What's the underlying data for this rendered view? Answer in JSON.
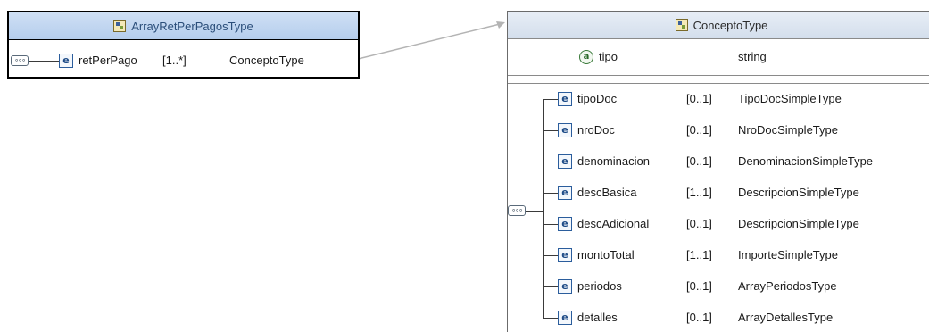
{
  "left_type": {
    "title": "ArrayRetPerPagosType",
    "element": {
      "name": "retPerPago",
      "cardinality": "[1..*]",
      "type": "ConceptoType"
    }
  },
  "right_type": {
    "title": "ConceptoType",
    "attribute": {
      "name": "tipo",
      "type": "string"
    },
    "elements": [
      {
        "name": "tipoDoc",
        "cardinality": "[0..1]",
        "type": "TipoDocSimpleType"
      },
      {
        "name": "nroDoc",
        "cardinality": "[0..1]",
        "type": "NroDocSimpleType"
      },
      {
        "name": "denominacion",
        "cardinality": "[0..1]",
        "type": "DenominacionSimpleType"
      },
      {
        "name": "descBasica",
        "cardinality": "[1..1]",
        "type": "DescripcionSimpleType"
      },
      {
        "name": "descAdicional",
        "cardinality": "[0..1]",
        "type": "DescripcionSimpleType"
      },
      {
        "name": "montoTotal",
        "cardinality": "[1..1]",
        "type": "ImporteSimpleType"
      },
      {
        "name": "periodos",
        "cardinality": "[0..1]",
        "type": "ArrayPeriodosType"
      },
      {
        "name": "detalles",
        "cardinality": "[0..1]",
        "type": "ArrayDetallesType"
      }
    ]
  },
  "icons": {
    "complex_type": "complex-type-icon",
    "element": "element-icon",
    "attribute": "attribute-icon",
    "sequence": "sequence-compositor-icon"
  },
  "glyphs": {
    "element": "e",
    "attribute": "a",
    "sequence": "∘∘∘"
  },
  "colors": {
    "left_header": "#b5cdec",
    "right_header": "#d3deec",
    "connector": "#b4b4b4"
  }
}
